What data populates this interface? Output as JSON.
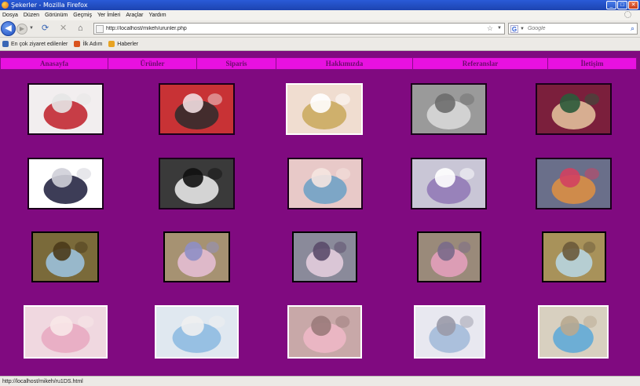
{
  "window": {
    "title": "Şekerler - Mozilla Firefox",
    "btn_minimize": "_",
    "btn_maximize": "□",
    "btn_close": "✕"
  },
  "menu": {
    "items": [
      "Dosya",
      "Düzen",
      "Görünüm",
      "Geçmiş",
      "Yer İmleri",
      "Araçlar",
      "Yardım"
    ]
  },
  "nav": {
    "back_glyph": "◀",
    "forward_glyph": "▶",
    "dropdown_glyph": "▼",
    "reload_glyph": "⟳",
    "stop_glyph": "✕",
    "home_glyph": "⌂",
    "url": "http://localhost/mikeh/urunler.php",
    "star_glyph": "☆",
    "url_dropdown_glyph": "▼",
    "search_engine_glyph": "G",
    "search_dropdown_glyph": "▼",
    "search_placeholder": "Google",
    "search_glyph": "⌕"
  },
  "bookmarks": [
    {
      "label": "En çok ziyaret edilenler",
      "color": "#3a66b5"
    },
    {
      "label": "İlk Adım",
      "color": "#d9531e"
    },
    {
      "label": "Haberler",
      "color": "#e8a323"
    }
  ],
  "site_nav": [
    "Anasayfa",
    "Ürünler",
    "Siparis",
    "Hakkımızda",
    "Referanslar",
    "İletişim"
  ],
  "products": [
    {
      "row": 1,
      "icon": "product-photo"
    }
  ],
  "product_palettes": [
    [
      "#f2eeef",
      "#c01d28",
      "#e6e6e6"
    ],
    [
      "#c83235",
      "#2b2b2b",
      "#f1dde0"
    ],
    [
      "#f0ddd0",
      "#c9a85a",
      "#ffffff"
    ],
    [
      "#9a9a9a",
      "#dcdcdc",
      "#6d6d6d"
    ],
    [
      "#7b1f3c",
      "#e8c8a0",
      "#2b5a3a"
    ],
    [
      "#ffffff",
      "#1b1b3a",
      "#cfcfd8"
    ],
    [
      "#3a3a3a",
      "#f0f0f0",
      "#111111"
    ],
    [
      "#e8c9c8",
      "#6aa0c5",
      "#f5e5e0"
    ],
    [
      "#c9c6d6",
      "#8f75b5",
      "#ffffff"
    ],
    [
      "#6a6f8a",
      "#e09040",
      "#d24060"
    ],
    [
      "#7a6a3a",
      "#9ec5e5",
      "#4a3a1a"
    ],
    [
      "#a69272",
      "#e8c0d8",
      "#8f8fc5"
    ],
    [
      "#8a8a9a",
      "#e8d0e0",
      "#5a4a6a"
    ],
    [
      "#9a8a7a",
      "#e8a0c0",
      "#7a6a8a"
    ],
    [
      "#a8925a",
      "#b8d8e8",
      "#6a5a3a"
    ],
    [
      "#f0d8e0",
      "#e8a8c0",
      "#f8e8e8"
    ],
    [
      "#e0e8f0",
      "#8ab8e0",
      "#f0f0f0"
    ],
    [
      "#c8a8a8",
      "#f0b8c8",
      "#9a7a7a"
    ],
    [
      "#e8e8f0",
      "#a0b8d8",
      "#9a9aa8"
    ],
    [
      "#d8d0c0",
      "#5aa8d8",
      "#b8a890"
    ]
  ],
  "status": {
    "text": "http://localhost/mikeh/ru1DS.html"
  }
}
